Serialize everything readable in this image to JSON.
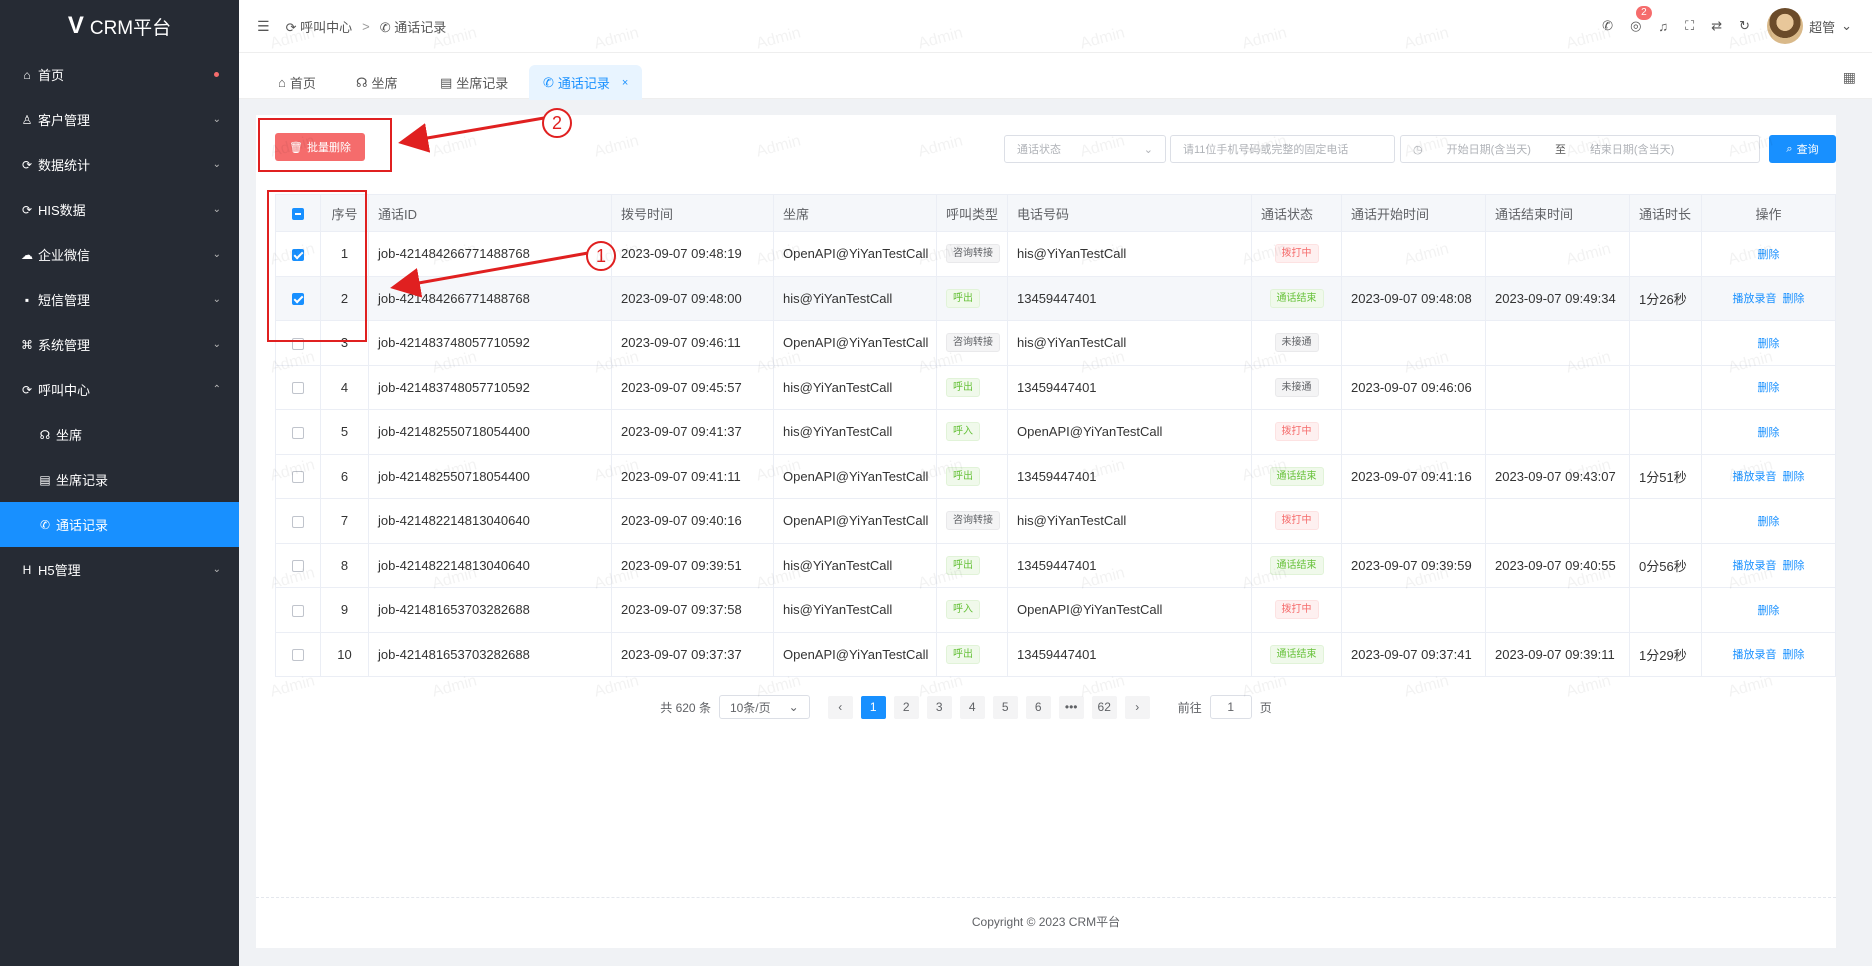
{
  "app": {
    "logo": "V",
    "title": "CRM平台"
  },
  "sidebar": {
    "items": [
      {
        "icon": "⌂",
        "label": "首页",
        "dot": true
      },
      {
        "icon": "♙",
        "label": "客户管理",
        "chev": "⌄"
      },
      {
        "icon": "⟳",
        "label": "数据统计",
        "chev": "⌄"
      },
      {
        "icon": "⟳",
        "label": "HIS数据",
        "chev": "⌄"
      },
      {
        "icon": "☁",
        "label": "企业微信",
        "chev": "⌄"
      },
      {
        "icon": "▪",
        "label": "短信管理",
        "chev": "⌄"
      },
      {
        "icon": "⌘",
        "label": "系统管理",
        "chev": "⌄"
      },
      {
        "icon": "⟳",
        "label": "呼叫中心",
        "chev": "⌃"
      },
      {
        "icon": "☊",
        "label": "坐席",
        "sub": true
      },
      {
        "icon": "▤",
        "label": "坐席记录",
        "sub": true
      },
      {
        "icon": "✆",
        "label": "通话记录",
        "sub": true,
        "active": true
      },
      {
        "icon": "H",
        "label": "H5管理",
        "chev": "⌄"
      }
    ]
  },
  "topbar": {
    "collapse_icon": "☰",
    "breadcrumb": [
      "呼叫中心",
      "通话记录"
    ],
    "breadcrumb_sep": ">",
    "notification_count": "2",
    "user_name": "超管",
    "user_chev": "⌄"
  },
  "tabs": [
    {
      "icon": "⌂",
      "label": "首页"
    },
    {
      "icon": "☊",
      "label": "坐席"
    },
    {
      "icon": "▤",
      "label": "坐席记录"
    },
    {
      "icon": "✆",
      "label": "通话记录",
      "active": true,
      "close": "×"
    }
  ],
  "toolbar": {
    "batch_delete_label": "批量删除",
    "status_placeholder": "通话状态",
    "phone_placeholder": "请11位手机号码或完整的固定电话",
    "date_start_placeholder": "开始日期(含当天)",
    "date_separator": "至",
    "date_end_placeholder": "结束日期(含当天)",
    "query_label": "查询"
  },
  "table": {
    "headers": [
      "",
      "序号",
      "通话ID",
      "拨号时间",
      "坐席",
      "呼叫类型",
      "电话号码",
      "通话状态",
      "通话开始时间",
      "通话结束时间",
      "通话时长",
      "操作"
    ],
    "rows": [
      {
        "checked": true,
        "no": "1",
        "id": "job-421484266771488768",
        "dial": "2023-09-07 09:48:19",
        "agent": "OpenAPI@YiYanTestCall",
        "type": "咨询转接",
        "type_color": "gray",
        "phone": "his@YiYanTestCall",
        "status": "拨打中",
        "status_color": "red",
        "start": "",
        "end": "",
        "duration": "",
        "ops": [
          "删除"
        ]
      },
      {
        "checked": true,
        "no": "2",
        "id": "job-421484266771488768",
        "dial": "2023-09-07 09:48:00",
        "agent": "his@YiYanTestCall",
        "type": "呼出",
        "type_color": "green",
        "phone": "13459447401",
        "status": "通话结束",
        "status_color": "green",
        "start": "2023-09-07 09:48:08",
        "end": "2023-09-07 09:49:34",
        "duration": "1分26秒",
        "ops": [
          "播放录音",
          "删除"
        ]
      },
      {
        "checked": false,
        "no": "3",
        "id": "job-421483748057710592",
        "dial": "2023-09-07 09:46:11",
        "agent": "OpenAPI@YiYanTestCall",
        "type": "咨询转接",
        "type_color": "gray",
        "phone": "his@YiYanTestCall",
        "status": "未接通",
        "status_color": "gray",
        "start": "",
        "end": "",
        "duration": "",
        "ops": [
          "删除"
        ]
      },
      {
        "checked": false,
        "no": "4",
        "id": "job-421483748057710592",
        "dial": "2023-09-07 09:45:57",
        "agent": "his@YiYanTestCall",
        "type": "呼出",
        "type_color": "green",
        "phone": "13459447401",
        "status": "未接通",
        "status_color": "gray",
        "start": "2023-09-07 09:46:06",
        "end": "",
        "duration": "",
        "ops": [
          "删除"
        ]
      },
      {
        "checked": false,
        "no": "5",
        "id": "job-421482550718054400",
        "dial": "2023-09-07 09:41:37",
        "agent": "his@YiYanTestCall",
        "type": "呼入",
        "type_color": "green",
        "phone": "OpenAPI@YiYanTestCall",
        "status": "拨打中",
        "status_color": "red",
        "start": "",
        "end": "",
        "duration": "",
        "ops": [
          "删除"
        ]
      },
      {
        "checked": false,
        "no": "6",
        "id": "job-421482550718054400",
        "dial": "2023-09-07 09:41:11",
        "agent": "OpenAPI@YiYanTestCall",
        "type": "呼出",
        "type_color": "green",
        "phone": "13459447401",
        "status": "通话结束",
        "status_color": "green",
        "start": "2023-09-07 09:41:16",
        "end": "2023-09-07 09:43:07",
        "duration": "1分51秒",
        "ops": [
          "播放录音",
          "删除"
        ]
      },
      {
        "checked": false,
        "no": "7",
        "id": "job-421482214813040640",
        "dial": "2023-09-07 09:40:16",
        "agent": "OpenAPI@YiYanTestCall",
        "type": "咨询转接",
        "type_color": "gray",
        "phone": "his@YiYanTestCall",
        "status": "拨打中",
        "status_color": "red",
        "start": "",
        "end": "",
        "duration": "",
        "ops": [
          "删除"
        ]
      },
      {
        "checked": false,
        "no": "8",
        "id": "job-421482214813040640",
        "dial": "2023-09-07 09:39:51",
        "agent": "his@YiYanTestCall",
        "type": "呼出",
        "type_color": "green",
        "phone": "13459447401",
        "status": "通话结束",
        "status_color": "green",
        "start": "2023-09-07 09:39:59",
        "end": "2023-09-07 09:40:55",
        "duration": "0分56秒",
        "ops": [
          "播放录音",
          "删除"
        ]
      },
      {
        "checked": false,
        "no": "9",
        "id": "job-421481653703282688",
        "dial": "2023-09-07 09:37:58",
        "agent": "his@YiYanTestCall",
        "type": "呼入",
        "type_color": "green",
        "phone": "OpenAPI@YiYanTestCall",
        "status": "拨打中",
        "status_color": "red",
        "start": "",
        "end": "",
        "duration": "",
        "ops": [
          "删除"
        ]
      },
      {
        "checked": false,
        "no": "10",
        "id": "job-421481653703282688",
        "dial": "2023-09-07 09:37:37",
        "agent": "OpenAPI@YiYanTestCall",
        "type": "呼出",
        "type_color": "green",
        "phone": "13459447401",
        "status": "通话结束",
        "status_color": "green",
        "start": "2023-09-07 09:37:41",
        "end": "2023-09-07 09:39:11",
        "duration": "1分29秒",
        "ops": [
          "播放录音",
          "删除"
        ]
      }
    ]
  },
  "pagination": {
    "total": "共 620 条",
    "page_size": "10条/页",
    "pages": [
      "1",
      "2",
      "3",
      "4",
      "5",
      "6",
      "•••",
      "62"
    ],
    "current": "1",
    "prev": "‹",
    "next": "›",
    "goto_label": "前往",
    "goto_value": "1",
    "goto_suffix": "页"
  },
  "footer": {
    "text": "Copyright © 2023 CRM平台"
  },
  "watermark": "Admin",
  "annotations": {
    "one": "1",
    "two": "2",
    "color": "#e02020"
  },
  "colors": {
    "primary": "#1890ff",
    "danger": "#f56c6c",
    "sidebar_bg": "#262b34"
  }
}
